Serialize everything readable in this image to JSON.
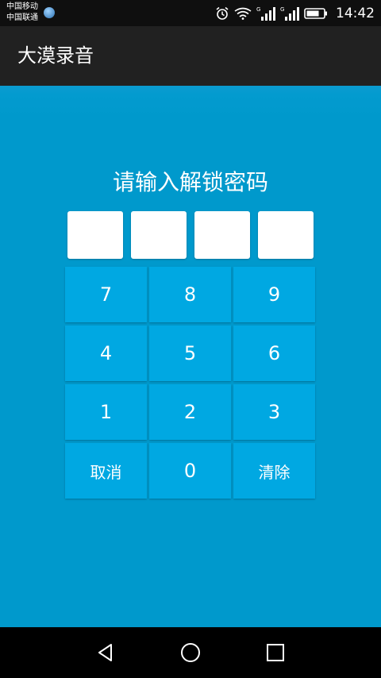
{
  "status_bar": {
    "carrier_1": "中国移动",
    "carrier_2": "中国联通",
    "time": "14:42",
    "icons": [
      "alarm-icon",
      "wifi-icon",
      "signal-icon",
      "signal-icon",
      "battery-icon"
    ]
  },
  "app_bar": {
    "title": "大漠录音"
  },
  "lock_screen": {
    "prompt": "请输入解锁密码",
    "pin_boxes": [
      "",
      "",
      "",
      ""
    ],
    "keys": {
      "k7": "7",
      "k8": "8",
      "k9": "9",
      "k4": "4",
      "k5": "5",
      "k6": "6",
      "k1": "1",
      "k2": "2",
      "k3": "3",
      "cancel": "取消",
      "k0": "0",
      "clear": "清除"
    }
  },
  "nav_bar": {
    "icons": [
      "back-icon",
      "home-icon",
      "recents-icon"
    ]
  },
  "colors": {
    "background": "#0099cc",
    "key": "#00a8e2",
    "app_bar": "#212121"
  }
}
